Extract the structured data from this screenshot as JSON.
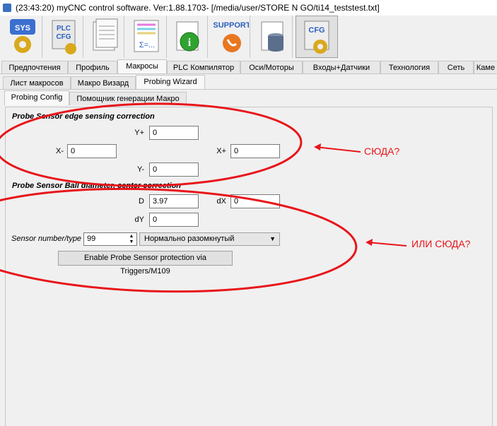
{
  "window": {
    "title": "(23:43:20)   myCNC control software. Ver:1.88.1703-   [/media/user/STORE N GO/ti14_teststest.txt]"
  },
  "toolbar": {
    "buttons": [
      {
        "label": "SYS",
        "icon": "sys-gear-icon"
      },
      {
        "label": "PLC CFG",
        "icon": "plc-cfg-icon"
      },
      {
        "label": "",
        "icon": "documents-icon"
      },
      {
        "label": "Σ=...",
        "icon": "formula-sheet-icon"
      },
      {
        "label": "",
        "icon": "info-icon"
      },
      {
        "label": "SUPPORT",
        "icon": "support-phone-icon"
      },
      {
        "label": "",
        "icon": "database-icon"
      },
      {
        "label": "CFG",
        "icon": "cfg-gear-icon"
      }
    ]
  },
  "main_tabs": [
    "Предпочтения",
    "Профиль",
    "Макросы",
    "PLC Компилятор",
    "Оси/Моторы",
    "Входы+Датчики",
    "Технология",
    "Сеть",
    "Каме"
  ],
  "main_tab_selected": "Макросы",
  "sub_tabs": [
    "Лист макросов",
    "Макро Визард",
    "Probing Wizard"
  ],
  "sub_tab_selected": "Probing Wizard",
  "inner_tabs": [
    "Probing Config",
    "Помощник генерации Макро"
  ],
  "inner_tab_selected": "Probing Config",
  "edge_section": {
    "title": "Probe Sensor edge sensing correction",
    "yplus_label": "Y+",
    "yplus_value": "0",
    "xminus_label": "X-",
    "xminus_value": "0",
    "xplus_label": "X+",
    "xplus_value": "0",
    "yminus_label": "Y-",
    "yminus_value": "0"
  },
  "ball_section": {
    "title": "Probe Sensor Ball diameter, center correction",
    "d_label": "D",
    "d_value": "3.97",
    "dx_label": "dX",
    "dx_value": "0",
    "dy_label": "dY",
    "dy_value": "0",
    "sensor_label": "Sensor number/type",
    "sensor_value": "99",
    "sensor_type": "Нормально разомкнутый",
    "enable_button": "Enable Probe Sensor protection via Triggers/M109"
  },
  "annotations": {
    "first": "СЮДА?",
    "second": "ИЛИ СЮДА?",
    "color": "#e8151a"
  }
}
